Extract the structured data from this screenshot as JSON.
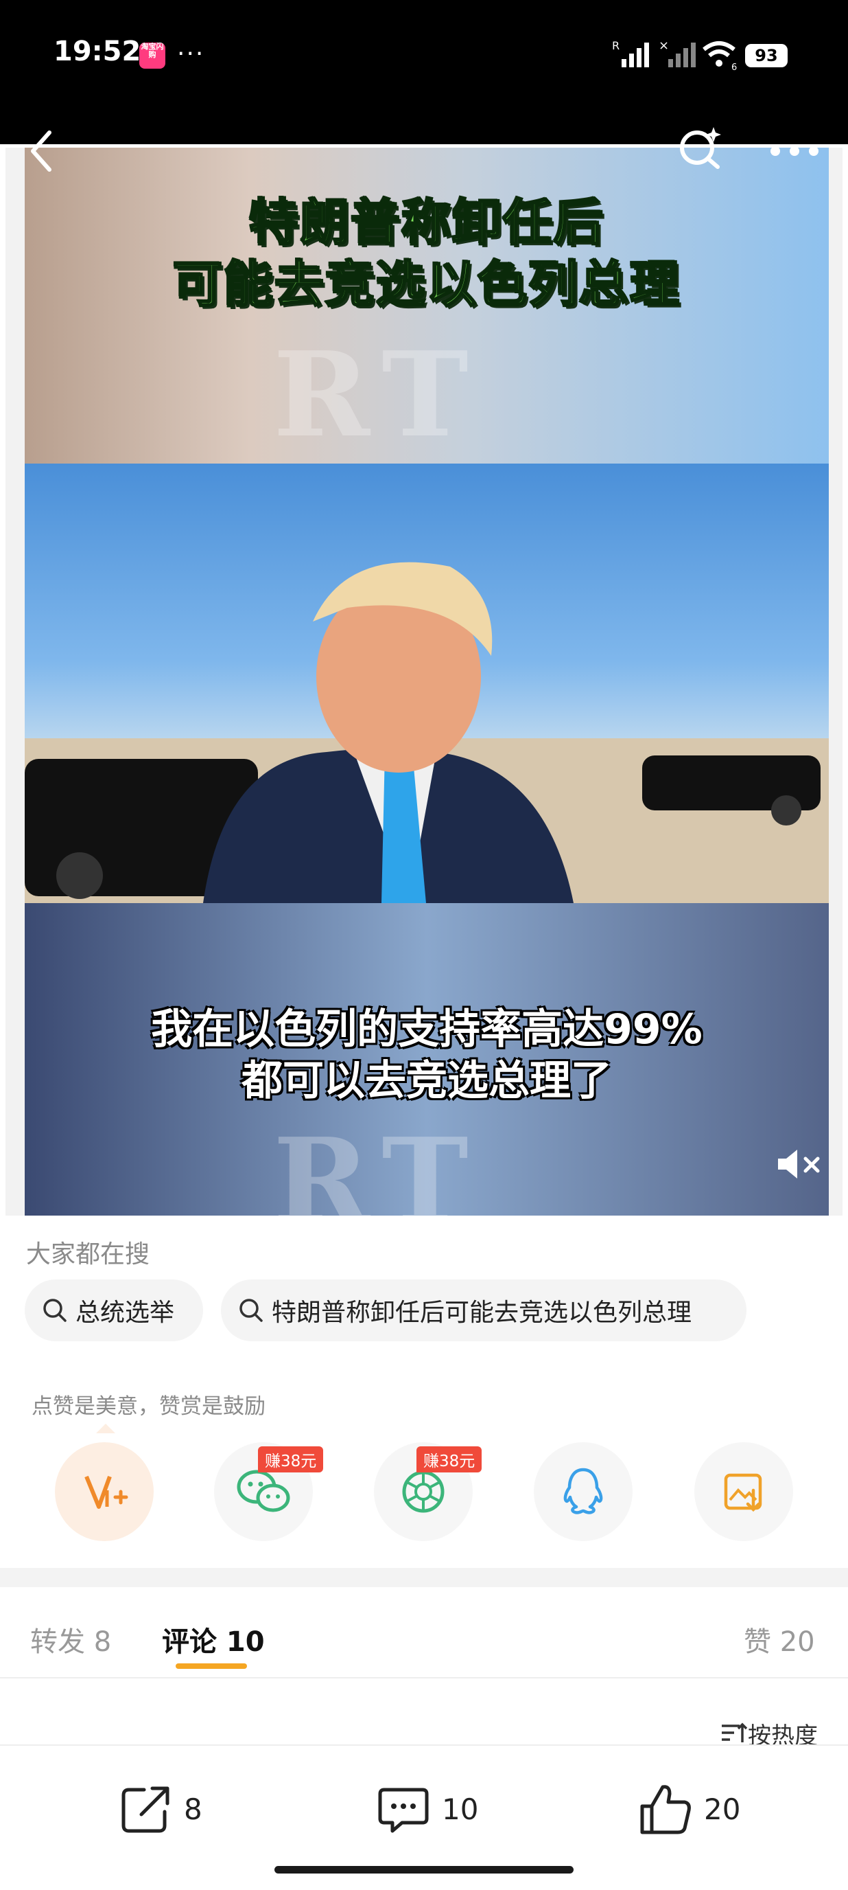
{
  "status_bar": {
    "time": "19:52",
    "app_badge": "淘宝闪购",
    "more": "···",
    "signal_1_label": "R",
    "signal_2_label": "×",
    "wifi_sub": "6",
    "battery": "93"
  },
  "video": {
    "headline_line1": "特朗普称卸任后",
    "headline_line2": "可能去竞选以色列总理",
    "watermark": "RT",
    "subtitle_line1": "我在以色列的支持率高达99%",
    "subtitle_line2": "都可以去竞选总理了"
  },
  "trending": {
    "label": "大家都在搜",
    "chips": [
      "总统选举",
      "特朗普称卸任后可能去竞选以色列总理"
    ]
  },
  "tip": {
    "label": "点赞是美意，赞赏是鼓励"
  },
  "share": {
    "reward_label_1": "赚38元",
    "reward_label_2": "赚38元"
  },
  "tabs": {
    "repost": "转发 8",
    "comment": "评论 10",
    "like": "赞 20"
  },
  "sort_label": "按热度",
  "actions": {
    "share_count": "8",
    "comment_count": "10",
    "like_count": "20"
  },
  "colors": {
    "accent": "#f5a623",
    "reward_tag": "#f04a3a",
    "headline_green": "#7ee15a"
  }
}
